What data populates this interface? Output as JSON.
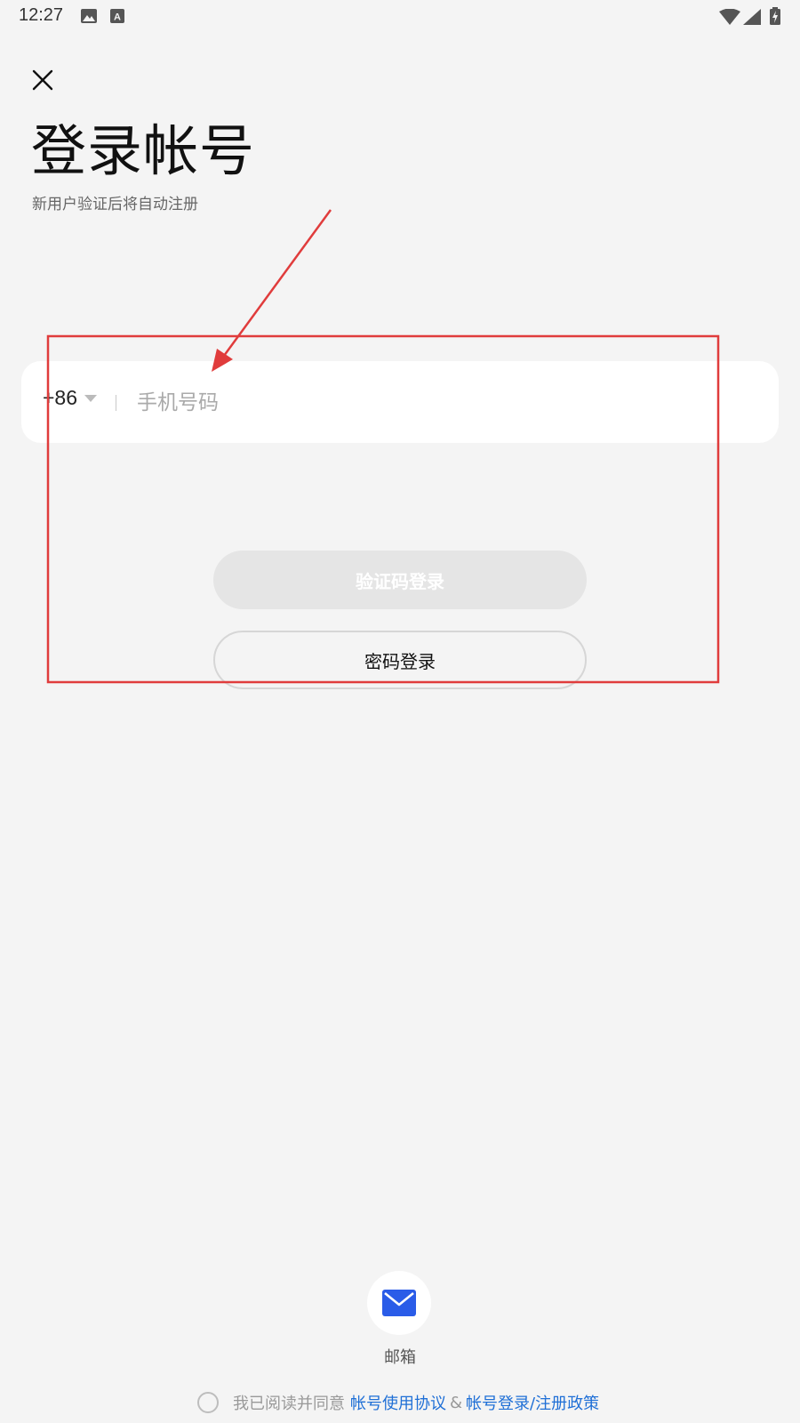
{
  "status_bar": {
    "time": "12:27",
    "icons": [
      "image-icon",
      "keyboard-a-icon",
      "wifi-icon",
      "signal-icon",
      "battery-charging-icon"
    ]
  },
  "header": {
    "close_icon": "close-icon",
    "title": "登录帐号",
    "subtitle": "新用户验证后将自动注册"
  },
  "phone": {
    "country_code": "+86",
    "placeholder": "手机号码",
    "value": ""
  },
  "buttons": {
    "code_login": "验证码登录",
    "password_login": "密码登录"
  },
  "alt_login": {
    "email_label": "邮箱",
    "icon": "mail-icon",
    "icon_color": "#2a5ce8"
  },
  "agreement": {
    "prefix": "我已阅读并同意",
    "link1": "帐号使用协议",
    "amp": "&",
    "link2": "帐号登录/注册政策"
  },
  "colors": {
    "link": "#1f6fd6",
    "annotation": "#e03c3c"
  }
}
